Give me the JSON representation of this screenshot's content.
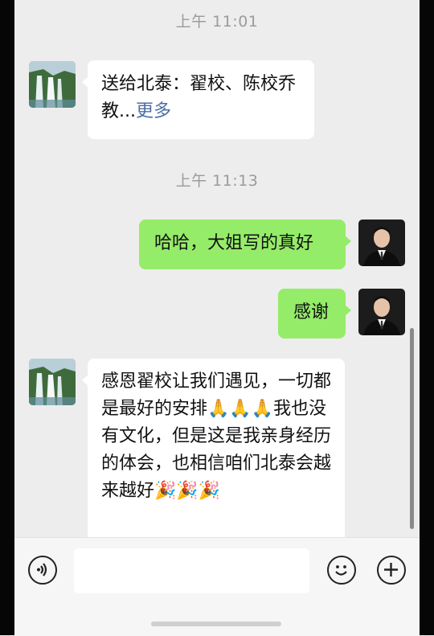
{
  "chat": {
    "timestamps": [
      "上午 11:01",
      "上午 11:13"
    ],
    "messages": [
      {
        "side": "left",
        "avatar": "waterfall-avatar",
        "text": "送给北泰：翟校、陈校乔教...",
        "more": "更多"
      },
      {
        "side": "right",
        "avatar": "man-in-suit-avatar",
        "text": "哈哈，大姐写的真好"
      },
      {
        "side": "right",
        "avatar": "man-in-suit-avatar",
        "text": "感谢"
      },
      {
        "side": "left",
        "avatar": "waterfall-avatar",
        "text": "感恩翟校让我们遇见，一切都是最好的安排🙏🙏🙏我也没有文化，但是这是我亲身经历的体会，也相信咱们北泰会越来越好🎉🎉🎉"
      }
    ]
  },
  "input_bar": {
    "voice_icon": "voice-icon",
    "emoji_icon": "smile-emoji-icon",
    "plus_icon": "plus-icon",
    "text_value": ""
  },
  "colors": {
    "background": "#ededed",
    "sent_bubble": "#95ec69",
    "received_bubble": "#ffffff",
    "more_link": "#4a6fa3",
    "timestamp": "#9b9b9b"
  }
}
